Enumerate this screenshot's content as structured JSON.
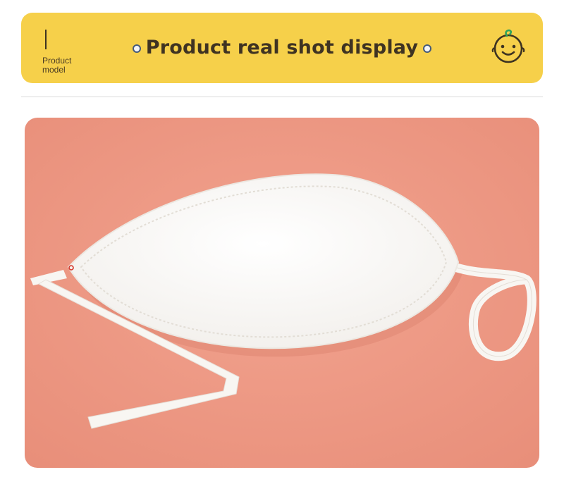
{
  "banner": {
    "model_label_line1": "Product",
    "model_label_line2": "model",
    "title": "Product real shot display",
    "bg_color": "#f6d04a",
    "mascot_icon": "baby-face-icon"
  },
  "photo": {
    "background_color": "#ef9a86",
    "subject": "product-photo",
    "item_color": "#fbfaf7"
  }
}
